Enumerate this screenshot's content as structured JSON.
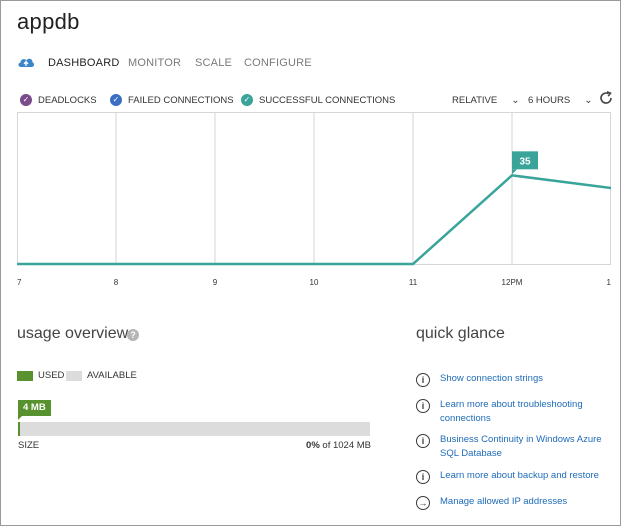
{
  "window": {
    "title": "appdb"
  },
  "tabs": [
    {
      "label": "DASHBOARD",
      "active": true
    },
    {
      "label": "MONITOR",
      "active": false
    },
    {
      "label": "SCALE",
      "active": false
    },
    {
      "label": "CONFIGURE",
      "active": false
    }
  ],
  "legend": [
    {
      "label": "DEADLOCKS",
      "color": "#7a4a8c",
      "icon": "check-circle-icon"
    },
    {
      "label": "FAILED CONNECTIONS",
      "color": "#3b6fc4",
      "icon": "check-circle-icon"
    },
    {
      "label": "SUCCESSFUL CONNECTIONS",
      "color": "#3aa49a",
      "icon": "check-circle-icon"
    }
  ],
  "controls": {
    "mode": "RELATIVE",
    "range": "6 HOURS",
    "refresh_icon": "refresh-icon"
  },
  "chart_data": {
    "type": "line",
    "categories": [
      "7",
      "8",
      "9",
      "10",
      "11",
      "12PM",
      "1"
    ],
    "series": [
      {
        "name": "SUCCESSFUL CONNECTIONS",
        "color": "#3aa49a",
        "values": [
          0,
          0,
          0,
          0,
          0,
          35,
          30
        ]
      }
    ],
    "ylim": [
      0,
      60
    ],
    "highlight": {
      "index": 5,
      "label": "35"
    },
    "grid": true
  },
  "usage": {
    "title": "usage overview",
    "help_icon": "help-icon",
    "legend_used": "USED",
    "legend_available": "AVAILABLE",
    "used_color": "#57922f",
    "available_color": "#dcdcdc",
    "used_label": "4 MB",
    "used_fraction": 0.004,
    "size_label": "SIZE",
    "percent": "0%",
    "of_text": "of 1024 MB"
  },
  "quick_glance": {
    "title": "quick glance",
    "links": [
      {
        "text": "Show connection strings",
        "icon": "info-icon"
      },
      {
        "text": "Learn more about troubleshooting connections",
        "icon": "info-icon"
      },
      {
        "text": "Business Continuity in Windows Azure SQL Database",
        "icon": "info-icon"
      },
      {
        "text": "Learn more about backup and restore",
        "icon": "info-icon"
      },
      {
        "text": "Manage allowed IP addresses",
        "icon": "arrow-right-circle-icon"
      }
    ]
  }
}
